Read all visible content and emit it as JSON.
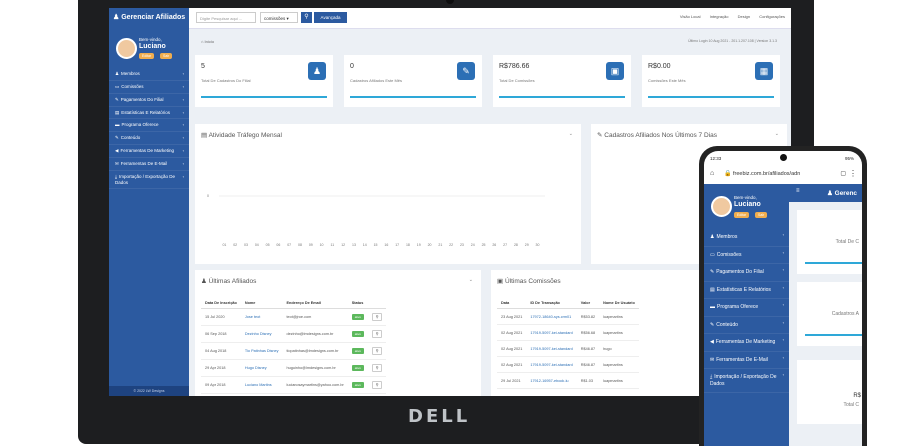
{
  "app": {
    "brand": "Gerenciar Afiliados",
    "footer": "© 2022 LW Designs"
  },
  "search": {
    "placeholder": "Digite Pesquisar aqui ...",
    "select_value": "comissões",
    "advanced_label": "Avançada"
  },
  "topnav": [
    "Visão Local",
    "Integração",
    "Design",
    "Configurações"
  ],
  "user": {
    "welcome": "Bem-vindo,",
    "name": "Luciano",
    "edit": "Editar",
    "exit": "Sair"
  },
  "sidebar": {
    "items": [
      {
        "label": "Membros"
      },
      {
        "label": "Comissões"
      },
      {
        "label": "Pagamentos Do Filial"
      },
      {
        "label": "Estatísticas E Relatórios"
      },
      {
        "label": "Programa Oferece"
      },
      {
        "label": "Conteúdo"
      },
      {
        "label": "Ferramentas De Marketing"
      },
      {
        "label": "Ferramentas De E-Mail"
      },
      {
        "label": "Importação / Exportação De Dados"
      }
    ]
  },
  "breadcrumb": "Início",
  "last_login": "Último Login 10 Aug 2021 - 201.1.207.108 | Version 3.1.3",
  "stats": [
    {
      "value": "5",
      "label": "Total De Cadastros Do Filial"
    },
    {
      "value": "0",
      "label": "Cadastros Afiliados Este Mês"
    },
    {
      "value": "R$786.66",
      "label": "Total De Comissões"
    },
    {
      "value": "R$0.00",
      "label": "Comissões Este Mês"
    }
  ],
  "panels": {
    "traffic": "Atividade Tráfego Mensal",
    "signups": "Cadastros Afiliados Nos Últimos 7 Dias",
    "latest_affiliates": "Últimas Afiliados",
    "latest_commissions": "Últimas Comissões"
  },
  "chart_data": {
    "type": "line",
    "x": [
      "01",
      "02",
      "03",
      "04",
      "05",
      "06",
      "07",
      "08",
      "09",
      "10",
      "11",
      "12",
      "13",
      "14",
      "15",
      "16",
      "17",
      "18",
      "19",
      "20",
      "21",
      "22",
      "23",
      "24",
      "25",
      "26",
      "27",
      "28",
      "29",
      "30"
    ],
    "y_ticks": [
      "0"
    ]
  },
  "affiliates_table": {
    "headers": [
      "Data De Inscrição",
      "Nome",
      "Endereço De Email",
      "Status"
    ],
    "rows": [
      [
        "15 Jul 2020",
        "Jose teot",
        "teot@jroe.com",
        "ativo"
      ],
      [
        "06 Sep 2018",
        "Dezinho Disney",
        "dezinho@lmdesigns.com.br",
        "ativo"
      ],
      [
        "04 Aug 2018",
        "Tio Patinhas Disney",
        "tiopatinhas@lmdesigns.com.br",
        "ativo"
      ],
      [
        "29 Apr 2018",
        "Hugo Disney",
        "huguinho@lmdesigns.com.br",
        "ativo"
      ],
      [
        "09 Apr 2018",
        "Luciano Martins",
        "lucianosaymartins@yahoo.com.br",
        "ativo"
      ]
    ]
  },
  "commissions_table": {
    "headers": [
      "Data",
      "ID De Transação",
      "Valor",
      "Nome De Usuário"
    ],
    "rows": [
      [
        "23 Aug 2021",
        "17972-18640-sys.crm01",
        "R$53.82",
        "luapmartins"
      ],
      [
        "02 Aug 2021",
        "17919-5097-kei-standard",
        "R$56.68",
        "luapmartins"
      ],
      [
        "02 Aug 2021",
        "17919-5097-kei-standard",
        "R$46.87",
        "hugo"
      ],
      [
        "02 Aug 2021",
        "17919-5097-kei-standard",
        "R$46.87",
        "luapmartins"
      ],
      [
        "29 Jul 2021",
        "17912-16957-ebook-lu",
        "R$1.03",
        "luapmartins"
      ]
    ]
  },
  "phone": {
    "time": "12:33",
    "signal": "95%",
    "url": "freebiz.com.br/afiliados/adn",
    "brand": "Gerenc",
    "sidebar_items": [
      "Membros",
      "Comissões",
      "Pagamentos Do Filial",
      "Estatísticas E Relatórios",
      "Programa Oferece",
      "Conteúdo",
      "Ferramentas De Marketing",
      "Ferramentas De E-Mail",
      "Importação / Exportação De Dados"
    ],
    "card_labels": [
      "Total De C",
      "Cadastros A",
      "R$",
      "Total C"
    ]
  },
  "laptop_brand": "DELL"
}
